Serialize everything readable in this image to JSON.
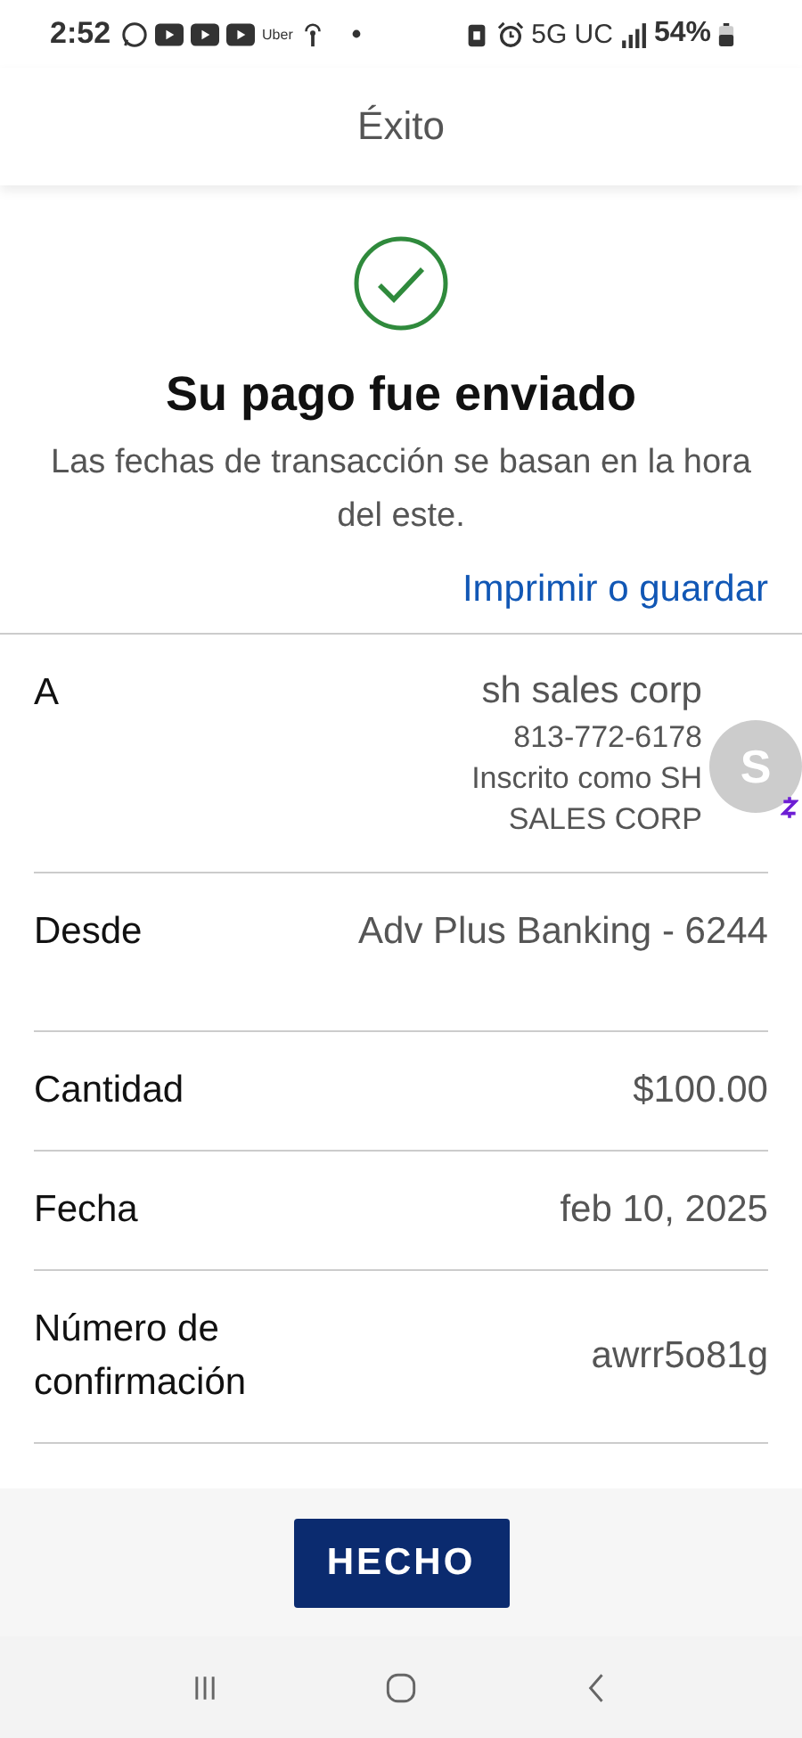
{
  "status_bar": {
    "time": "2:52",
    "uber": "Uber",
    "network": "5G UC",
    "battery": "54%"
  },
  "header": {
    "title": "Éxito"
  },
  "success": {
    "heading": "Su pago fue enviado",
    "note": "Las fechas de transacción se basan en la hora del este."
  },
  "print_link": "Imprimir o guardar",
  "details": [
    {
      "kind": "recipient",
      "label": "A",
      "name": "sh sales corp",
      "phone": "813-772-6178",
      "enrolled": "Inscrito como SH SALES CORP",
      "avatar_letter": "S"
    },
    {
      "kind": "text",
      "label": "Desde",
      "value": "Adv Plus Banking - 6244"
    },
    {
      "kind": "text",
      "label": "Cantidad",
      "value": "$100.00"
    },
    {
      "kind": "text",
      "label": "Fecha",
      "value": "feb 10, 2025"
    },
    {
      "kind": "text",
      "label": "Número de confirmación",
      "value": "awrr5o81g"
    }
  ],
  "done_button": "HECHO"
}
